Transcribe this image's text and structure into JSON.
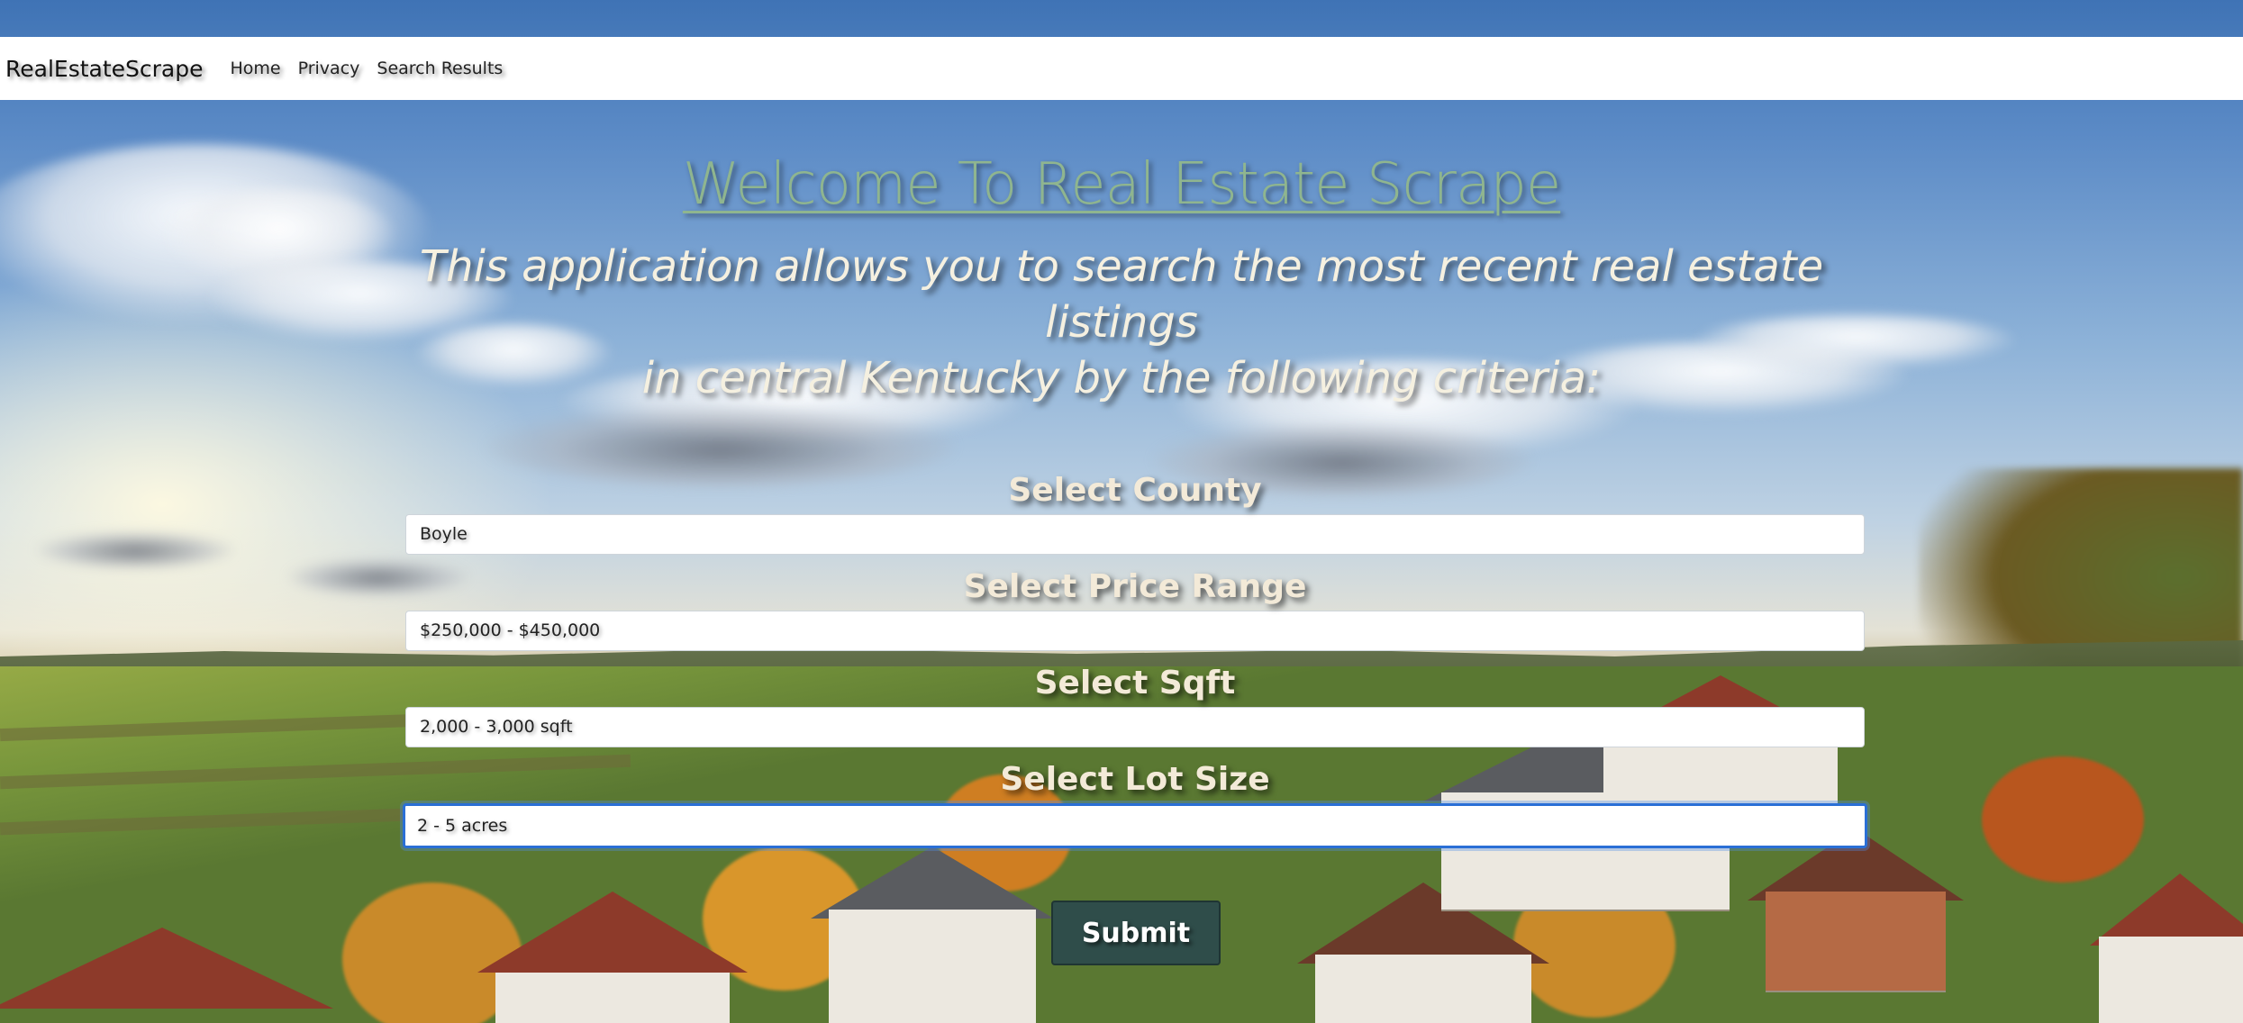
{
  "navbar": {
    "brand": "RealEstateScrape",
    "links": [
      "Home",
      "Privacy",
      "Search Results"
    ]
  },
  "hero": {
    "title": "Welcome To Real Estate Scrape",
    "subtitle_line1": "This application allows you to search the most recent real estate listings",
    "subtitle_line2": "in central Kentucky by the following criteria:"
  },
  "form": {
    "county": {
      "label": "Select County",
      "value": "Boyle"
    },
    "price": {
      "label": "Select Price Range",
      "value": "$250,000 - $450,000"
    },
    "sqft": {
      "label": "Select Sqft",
      "value": "2,000 - 3,000 sqft"
    },
    "lot": {
      "label": "Select Lot Size",
      "value": "2 - 5 acres",
      "focused": true
    },
    "submit_label": "Submit"
  },
  "colors": {
    "title": "#8fb58f",
    "submit_bg": "#2f4d4a",
    "focus_border": "#2a6fd6"
  }
}
